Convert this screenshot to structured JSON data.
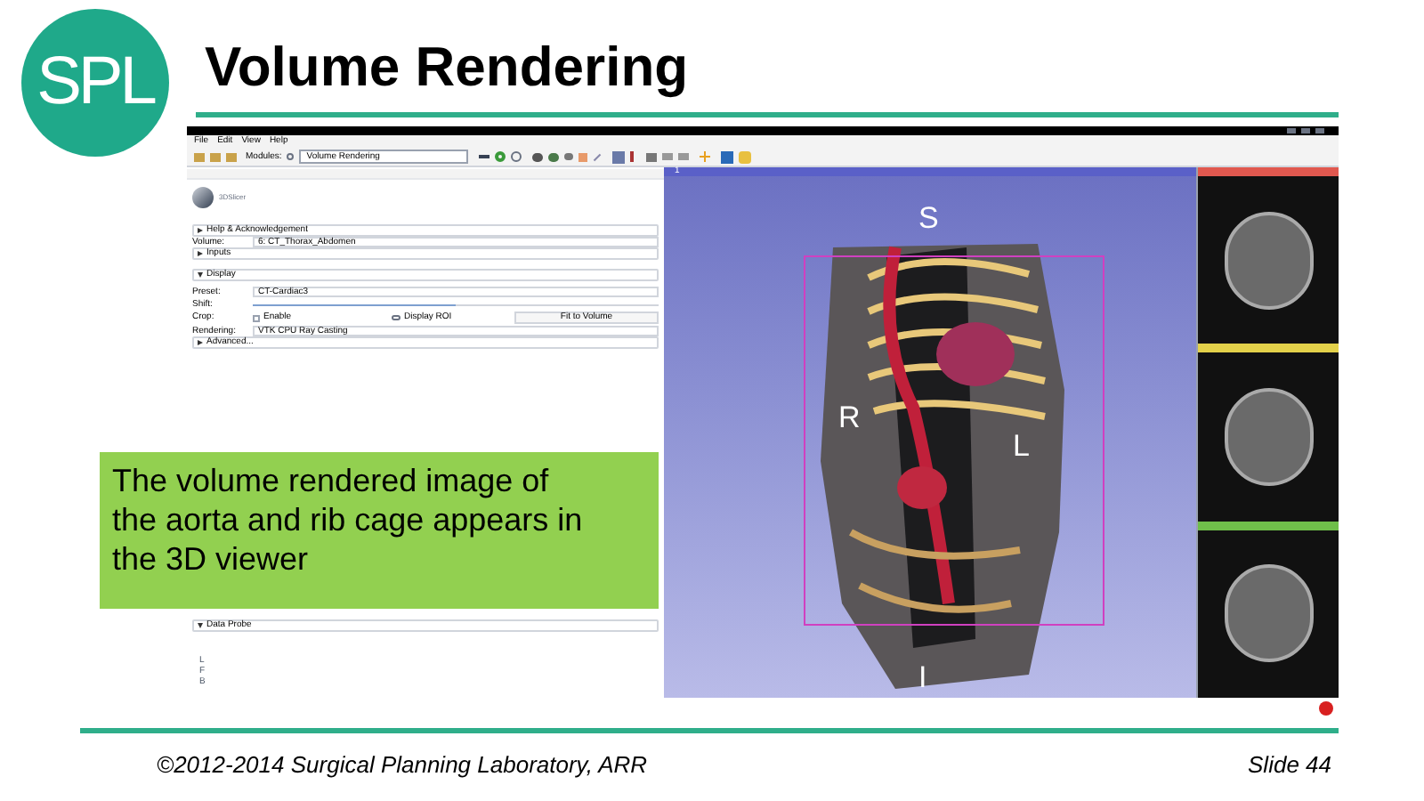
{
  "logo": {
    "text": "SPL"
  },
  "title": "Volume Rendering",
  "app": {
    "menu": [
      "File",
      "Edit",
      "View",
      "Help"
    ],
    "toolbar": {
      "modules_label": "Modules:",
      "module": "Volume Rendering"
    },
    "brand": "3DSlicer",
    "panel": [
      {
        "kind": "section",
        "label": "Help & Acknowledgement",
        "expanded": false
      },
      {
        "kind": "combo",
        "label": "Volume:",
        "value": "6: CT_Thorax_Abdomen"
      },
      {
        "kind": "section",
        "label": "Inputs",
        "expanded": false
      },
      {
        "kind": "section",
        "label": "Display",
        "expanded": true
      },
      {
        "kind": "combo",
        "label": "Preset:",
        "value": "CT-Cardiac3"
      },
      {
        "kind": "slider",
        "label": "Shift:",
        "level": 0.5
      },
      {
        "kind": "crop",
        "label": "Crop:",
        "checkbox": {
          "label": "Enable",
          "checked": false
        },
        "toggle": "Display ROI",
        "button": "Fit to Volume"
      },
      {
        "kind": "combo",
        "label": "Rendering:",
        "value": "VTK CPU Ray Casting"
      },
      {
        "kind": "section",
        "label": "Advanced...",
        "expanded": false
      }
    ],
    "data_probe": {
      "label": "Data Probe",
      "expanded": true,
      "labels": [
        "L",
        "F",
        "B"
      ]
    },
    "viewer": {
      "number": "1",
      "orientation": {
        "top": "S",
        "left": "R",
        "right": "L",
        "bottom": "I"
      }
    },
    "slice_views": [
      {
        "color": "#e0584f"
      },
      {
        "color": "#e3d14a"
      },
      {
        "color": "#6fbf4a"
      }
    ]
  },
  "callout": "The volume rendered image of the aorta and rib cage appears in the 3D viewer",
  "footer": {
    "copyright": "©2012-2014 Surgical Planning Laboratory, ARR",
    "slide": "Slide 44"
  }
}
